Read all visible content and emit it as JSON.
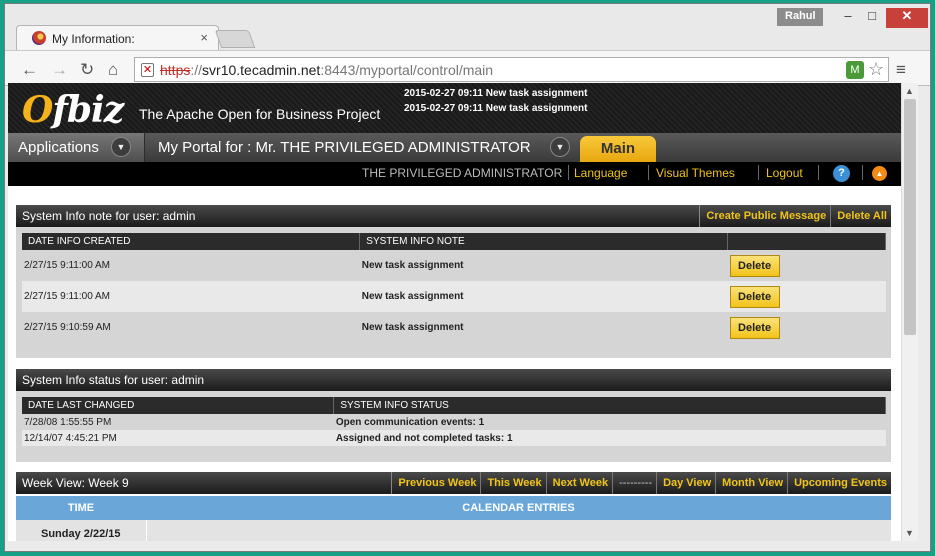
{
  "browser": {
    "tab_title": "My Information:",
    "tab_close": "×",
    "profile": "Rahul",
    "window_min": "–",
    "window_max": "□",
    "window_close": "✕",
    "url_scheme": "https",
    "url_sep": "://",
    "url_host": "svr10.tecadmin.net",
    "url_rest": ":8443/myportal/control/main",
    "icons": {
      "back": "back-arrow-icon",
      "forward": "forward-arrow-icon",
      "reload": "reload-icon",
      "home": "home-icon",
      "star": "star-icon",
      "menu": "menu-icon"
    }
  },
  "header": {
    "logo_o": "O",
    "logo_rest": "fbiz",
    "tagline": "The Apache Open for Business Project",
    "notifications": [
      "2015-02-27 09:11 New task assignment",
      "2015-02-27 09:11 New task assignment"
    ]
  },
  "nav": {
    "applications": "Applications",
    "portal": "My Portal for : Mr. THE PRIVILEGED ADMINISTRATOR",
    "main": "Main"
  },
  "userbar": {
    "user": "THE PRIVILEGED ADMINISTRATOR",
    "language": "Language",
    "themes": "Visual Themes",
    "logout": "Logout",
    "help": "?",
    "up": "▲"
  },
  "info_notes": {
    "title": "System Info note for user: admin",
    "links": [
      "Create Public Message",
      "Delete All"
    ],
    "columns": [
      "DATE INFO CREATED",
      "SYSTEM INFO NOTE",
      ""
    ],
    "rows": [
      {
        "date": "2/27/15 9:11:00 AM",
        "note": "New task assignment",
        "action": "Delete"
      },
      {
        "date": "2/27/15 9:11:00 AM",
        "note": "New task assignment",
        "action": "Delete"
      },
      {
        "date": "2/27/15 9:10:59 AM",
        "note": "New task assignment",
        "action": "Delete"
      }
    ]
  },
  "info_status": {
    "title": "System Info status for user: admin",
    "columns": [
      "DATE LAST CHANGED",
      "SYSTEM INFO STATUS"
    ],
    "rows": [
      {
        "date": "7/28/08 1:55:55 PM",
        "status": "Open communication events: 1"
      },
      {
        "date": "12/14/07 4:45:21 PM",
        "status": "Assigned and not completed tasks: 1"
      }
    ]
  },
  "week": {
    "title": "Week View: Week 9",
    "links": [
      "Previous Week",
      "This Week",
      "Next Week",
      "---------",
      "Day View",
      "Month View",
      "Upcoming Events"
    ],
    "columns": [
      "TIME",
      "CALENDAR ENTRIES"
    ],
    "first_day": "Sunday 2/22/15"
  }
}
